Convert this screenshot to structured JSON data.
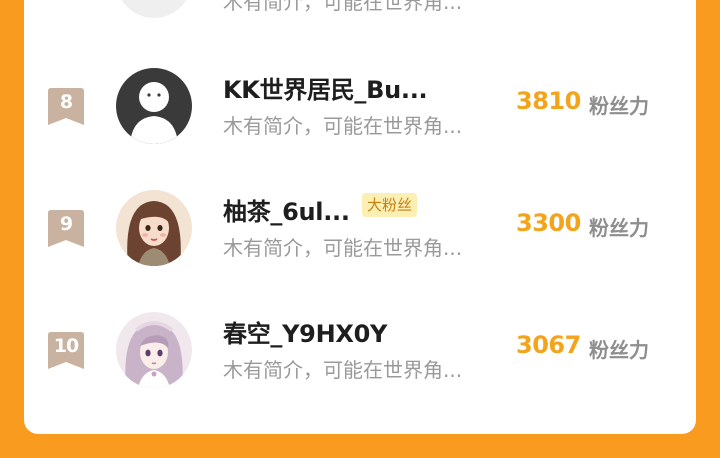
{
  "top_partial_row": {
    "intro": "木有简介，可能在世界角..."
  },
  "ranking": [
    {
      "rank": "8",
      "name": "KK世界居民_Bu...",
      "badge": "",
      "intro": "木有简介，可能在世界角...",
      "score": "3810",
      "score_unit": "粉丝力",
      "avatar": "default-silhouette-avatar"
    },
    {
      "rank": "9",
      "name": "柚茶_6ul...",
      "badge": "大粉丝",
      "intro": "木有简介，可能在世界角...",
      "score": "3300",
      "score_unit": "粉丝力",
      "avatar": "girl-illustration-avatar"
    },
    {
      "rank": "10",
      "name": "春空_Y9HX0Y",
      "badge": "",
      "intro": "木有简介，可能在世界角...",
      "score": "3067",
      "score_unit": "粉丝力",
      "avatar": "anime-girl-avatar"
    }
  ],
  "colors": {
    "page_background": "#F99B1F",
    "card_background": "#FFFFFF",
    "rank_badge": "#C9B29F",
    "score": "#F2A41D",
    "badge_bg": "#FCEFB4",
    "badge_text": "#C77F10"
  }
}
